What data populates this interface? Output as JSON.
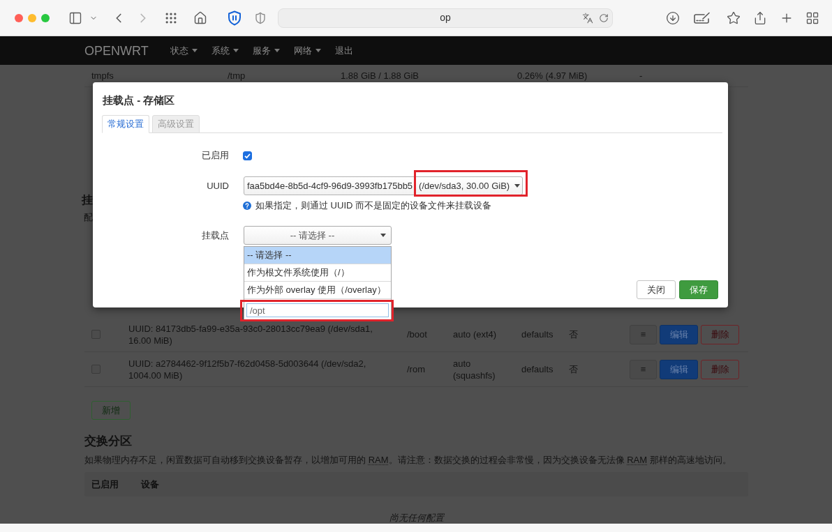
{
  "browser": {
    "address": "op"
  },
  "navbar": {
    "brand": "OPENWRT",
    "menu": [
      {
        "label": "状态",
        "dropdown": true
      },
      {
        "label": "系统",
        "dropdown": true
      },
      {
        "label": "服务",
        "dropdown": true
      },
      {
        "label": "网络",
        "dropdown": true
      },
      {
        "label": "退出",
        "dropdown": false
      }
    ]
  },
  "storage_table": {
    "rows": [
      {
        "cells": [
          "tmpfs",
          "/tmp",
          "1.88 GiB / 1.88 GiB",
          "0.26% (4.97 MiB)",
          "-"
        ]
      }
    ]
  },
  "mount_section": {
    "title": "挂",
    "description": "配",
    "rows": [
      {
        "checked": false,
        "device": "UUID: 84173db5-fa99-e35a-93c0-28013cc79ea9 (/dev/sda1, 16.00 MiB)",
        "mount_point": "/boot",
        "filesystem": "auto (ext4)",
        "options": "defaults",
        "fsck": "否",
        "actions": [
          {
            "kind": "handle",
            "label": "≡"
          },
          {
            "kind": "edit",
            "label": "编辑"
          },
          {
            "kind": "delete",
            "label": "删除"
          }
        ]
      },
      {
        "checked": false,
        "device": "UUID: a2784462-9f12f5b7-f62d0458-5d003644 (/dev/sda2, 1004.00 MiB)",
        "mount_point": "/rom",
        "filesystem": "auto (squashfs)",
        "options": "defaults",
        "fsck": "否",
        "actions": [
          {
            "kind": "handle",
            "label": "≡"
          },
          {
            "kind": "edit",
            "label": "编辑"
          },
          {
            "kind": "delete",
            "label": "删除"
          }
        ]
      }
    ],
    "add_button": "新增"
  },
  "swap_section": {
    "title": "交换分区",
    "description": [
      {
        "kind": "text",
        "text": "如果物理内存不足，闲置数据可自动移到交换设备暂存，以增加可用的 "
      },
      {
        "kind": "abbr",
        "text": "RAM"
      },
      {
        "kind": "text",
        "text": "。请注意：数据交换的过程会非常慢，因为交换设备无法像 "
      },
      {
        "kind": "abbr",
        "text": "RAM"
      },
      {
        "kind": "text",
        "text": " 那样的高速地访问。"
      }
    ],
    "columns": [
      "已启用",
      "设备"
    ],
    "empty_text": "尚无任何配置"
  },
  "modal": {
    "title": "挂载点 - 存储区",
    "tabs": [
      {
        "label": "常规设置",
        "selected": true
      },
      {
        "label": "高级设置",
        "selected": false
      }
    ],
    "fields": [
      {
        "kind": "checkbox",
        "label": "已启用",
        "checked": true
      },
      {
        "kind": "select",
        "label": "UUID",
        "value": "faa5bd4e-8b5d-4cf9-96d9-3993fb175bb5",
        "detail": "(/dev/sda3, 30.00 GiB)",
        "annotated": true,
        "help": "如果指定，则通过 UUID 而不是固定的设备文件来挂载设备"
      },
      {
        "kind": "combobox",
        "label": "挂载点",
        "value": "-- 请选择 --",
        "expanded": true,
        "options": [
          {
            "label": "-- 请选择 --",
            "selected": true
          },
          {
            "label": "作为根文件系统使用（/）",
            "selected": false
          },
          {
            "label": "作为外部 overlay 使用（/overlay）",
            "selected": false
          }
        ],
        "custom_input": {
          "value": "/opt",
          "annotated": true
        }
      }
    ],
    "buttons": [
      {
        "kind": "close",
        "label": "关闭"
      },
      {
        "kind": "save",
        "label": "保存"
      }
    ]
  }
}
